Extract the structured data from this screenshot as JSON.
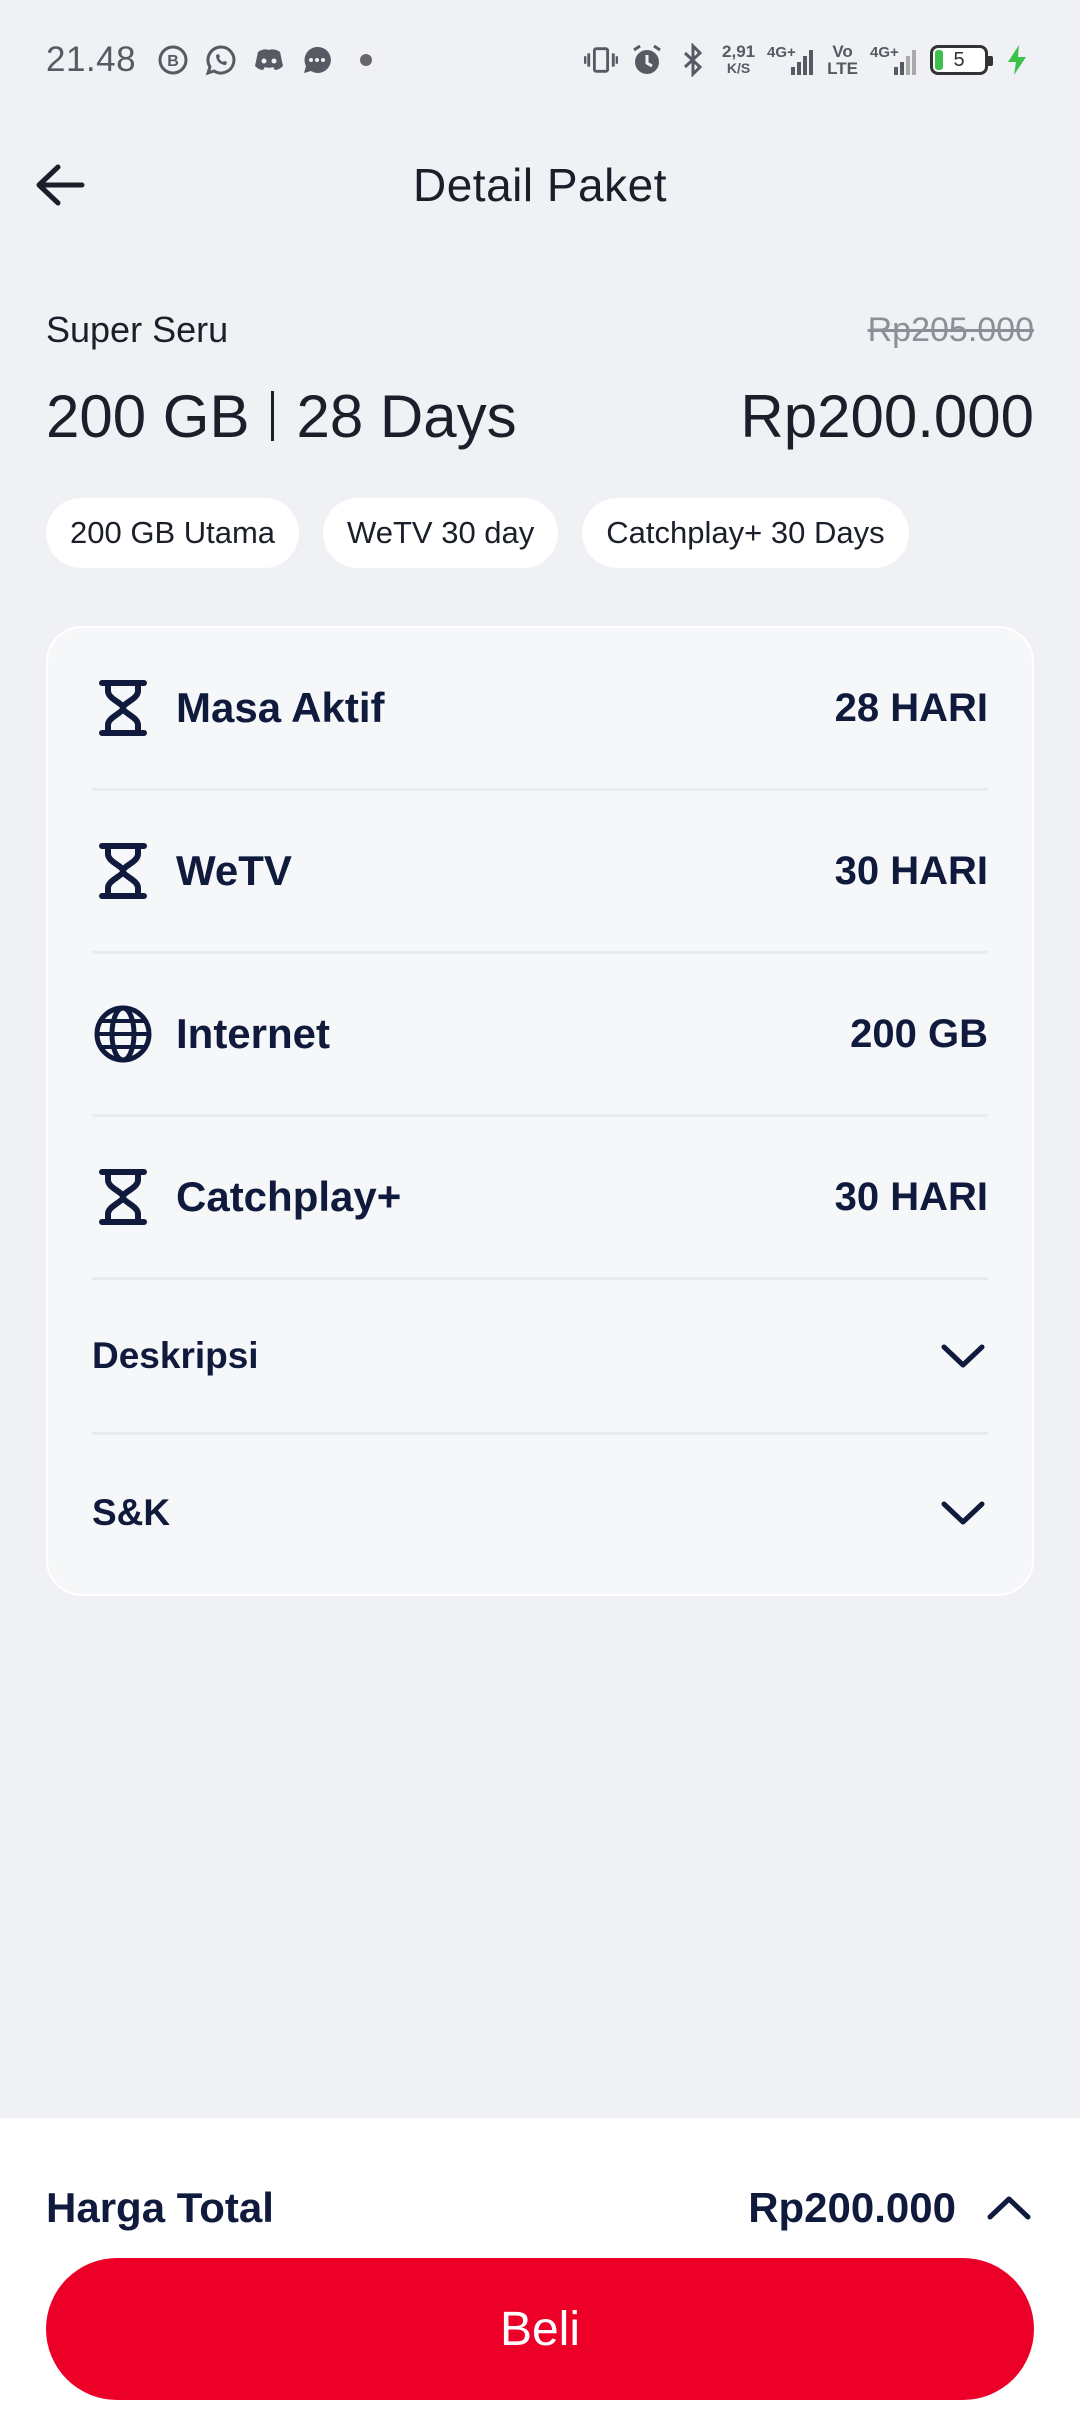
{
  "status_bar": {
    "time": "21.48",
    "net_speed_value": "2,91",
    "net_speed_unit": "K/S",
    "net1": "4G+",
    "volte_top": "Vo",
    "volte_bottom": "LTE",
    "net2": "4G+",
    "battery": "5"
  },
  "header": {
    "title": "Detail Paket"
  },
  "summary": {
    "name": "Super Seru",
    "old_price": "Rp205.000",
    "quota": "200 GB",
    "duration": "28 Days",
    "price": "Rp200.000"
  },
  "chips": [
    "200 GB Utama",
    "WeTV 30 day",
    "Catchplay+ 30 Days"
  ],
  "details": [
    {
      "icon": "hourglass-icon",
      "label": "Masa Aktif",
      "value": "28 HARI"
    },
    {
      "icon": "hourglass-icon",
      "label": "WeTV",
      "value": "30 HARI"
    },
    {
      "icon": "globe-icon",
      "label": "Internet",
      "value": "200 GB"
    },
    {
      "icon": "hourglass-icon",
      "label": "Catchplay+",
      "value": "30 HARI"
    }
  ],
  "accordions": [
    "Deskripsi",
    "S&K"
  ],
  "footer": {
    "total_label": "Harga Total",
    "total_price": "Rp200.000",
    "buy_label": "Beli"
  },
  "colors": {
    "primary": "#ec0028",
    "text_dark": "#0f1a3d",
    "background": "#eff1f4"
  }
}
